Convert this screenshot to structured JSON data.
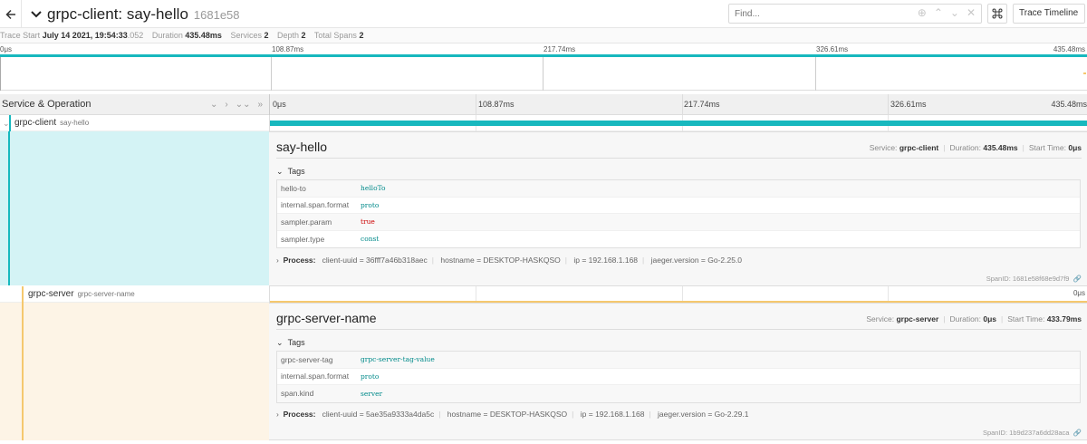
{
  "header": {
    "title": "grpc-client: say-hello",
    "trace_id": "1681e58",
    "find_placeholder": "Find...",
    "find_ctrl_icons": [
      "⊕",
      "⌃",
      "⌄",
      "✕"
    ],
    "view_select": "Trace Timeline"
  },
  "summary": {
    "trace_start_label": "Trace Start",
    "trace_start_value": "July 14 2021, 19:54:33",
    "trace_start_ms": ".052",
    "duration_label": "Duration",
    "duration_value": "435.48ms",
    "services_label": "Services",
    "services_value": "2",
    "depth_label": "Depth",
    "depth_value": "2",
    "total_spans_label": "Total Spans",
    "total_spans_value": "2"
  },
  "minimap": {
    "ticks": [
      "0μs",
      "108.87ms",
      "217.74ms",
      "326.61ms",
      "435.48ms"
    ]
  },
  "timeline": {
    "svc_op_label": "Service & Operation",
    "controls": [
      "⌄",
      "›",
      "⌄⌄",
      "»"
    ],
    "ticks": [
      "0μs",
      "108.87ms",
      "217.74ms",
      "326.61ms",
      "435.48ms"
    ]
  },
  "spans": [
    {
      "service": "grpc-client",
      "operation": "say-hello",
      "color": "#17b8be",
      "bg": "#d4f3f5",
      "detail": {
        "title": "say-hello",
        "service_label": "Service:",
        "service": "grpc-client",
        "duration_label": "Duration:",
        "duration": "435.48ms",
        "start_label": "Start Time:",
        "start": "0μs",
        "tags_label": "Tags",
        "tags": [
          {
            "key": "hello-to",
            "value": "helloTo"
          },
          {
            "key": "internal.span.format",
            "value": "proto"
          },
          {
            "key": "sampler.param",
            "value": "true"
          },
          {
            "key": "sampler.type",
            "value": "const"
          }
        ],
        "process_label": "Process:",
        "process": [
          {
            "key": "client-uuid",
            "value": "36fff7a46b318aec"
          },
          {
            "key": "hostname",
            "value": "DESKTOP-HASKQSO"
          },
          {
            "key": "ip",
            "value": "192.168.1.168"
          },
          {
            "key": "jaeger.version",
            "value": "Go-2.25.0"
          }
        ],
        "span_id_label": "SpanID:",
        "span_id": "1681e58f68e9d7f9"
      }
    },
    {
      "service": "grpc-server",
      "operation": "grpc-server-name",
      "color": "#f5c86e",
      "bar_label": "0μs",
      "bg": "#fdf4e6",
      "detail": {
        "title": "grpc-server-name",
        "service_label": "Service:",
        "service": "grpc-server",
        "duration_label": "Duration:",
        "duration": "0μs",
        "start_label": "Start Time:",
        "start": "433.79ms",
        "tags_label": "Tags",
        "tags": [
          {
            "key": "grpc-server-tag",
            "value": "grpc-server-tag-value"
          },
          {
            "key": "internal.span.format",
            "value": "proto"
          },
          {
            "key": "span.kind",
            "value": "server"
          }
        ],
        "process_label": "Process:",
        "process": [
          {
            "key": "client-uuid",
            "value": "5ae35a9333a4da5c"
          },
          {
            "key": "hostname",
            "value": "DESKTOP-HASKQSO"
          },
          {
            "key": "ip",
            "value": "192.168.1.168"
          },
          {
            "key": "jaeger.version",
            "value": "Go-2.29.1"
          }
        ],
        "span_id_label": "SpanID:",
        "span_id": "1b9d237a6dd28aca"
      }
    }
  ]
}
